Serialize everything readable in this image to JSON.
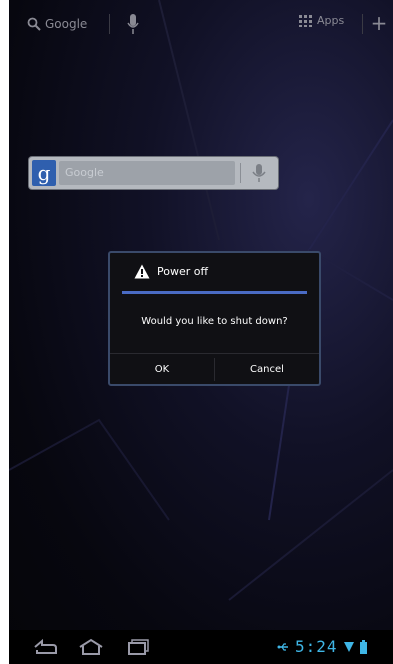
{
  "top_bar": {
    "search_label": "Google",
    "apps_label": "Apps"
  },
  "google_widget": {
    "logo_letter": "g",
    "field_placeholder": "Google"
  },
  "dialog": {
    "title": "Power off",
    "message": "Would you like to shut down?",
    "ok_label": "OK",
    "cancel_label": "Cancel",
    "accent_color": "#4a6bc4"
  },
  "status_bar": {
    "time": "5:24",
    "clock_color": "#3fb6e6"
  },
  "icons": {
    "top_search": "search-icon",
    "top_mic": "microphone-icon",
    "apps": "apps-grid-icon",
    "add": "plus-icon",
    "widget_mic": "microphone-icon",
    "dialog": "warning-icon",
    "nav_back": "back-icon",
    "nav_home": "home-icon",
    "nav_recent": "recent-apps-icon",
    "status_usb": "usb-icon",
    "status_wifi": "wifi-icon",
    "status_battery": "battery-icon"
  }
}
